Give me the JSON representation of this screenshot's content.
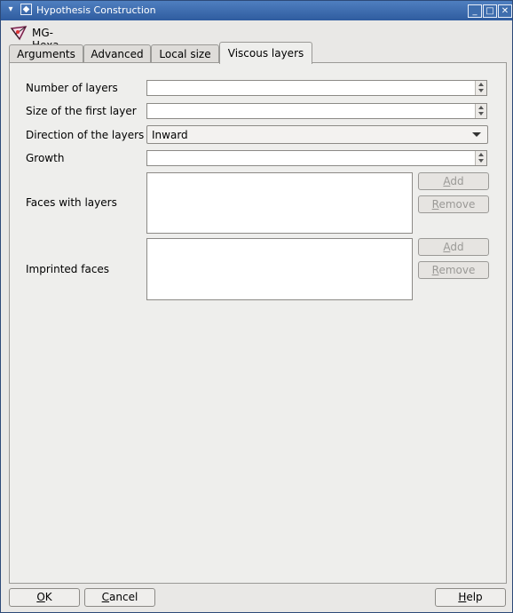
{
  "window": {
    "title": "Hypothesis Construction"
  },
  "header": {
    "name": "MG-Hexa"
  },
  "tabs": [
    {
      "label": "Arguments",
      "active": false
    },
    {
      "label": "Advanced",
      "active": false
    },
    {
      "label": "Local size",
      "active": false
    },
    {
      "label": "Viscous layers",
      "active": true
    }
  ],
  "form": {
    "number_of_layers": {
      "label": "Number of layers",
      "value": ""
    },
    "size_first_layer": {
      "label": "Size of the first layer",
      "value": ""
    },
    "direction": {
      "label": "Direction of the layers",
      "value": "Inward"
    },
    "growth": {
      "label": "Growth",
      "value": ""
    },
    "faces_with_layers": {
      "label": "Faces with layers",
      "add_mnemonic": "A",
      "add_rest": "dd",
      "remove_mnemonic": "R",
      "remove_rest": "emove"
    },
    "imprinted_faces": {
      "label": "Imprinted faces",
      "add_mnemonic": "A",
      "add_rest": "dd",
      "remove_mnemonic": "R",
      "remove_rest": "emove"
    }
  },
  "footer": {
    "ok_mnemonic": "O",
    "ok_rest": "K",
    "cancel_mnemonic": "C",
    "cancel_rest": "ancel",
    "help_mnemonic": "H",
    "help_rest": "elp"
  }
}
